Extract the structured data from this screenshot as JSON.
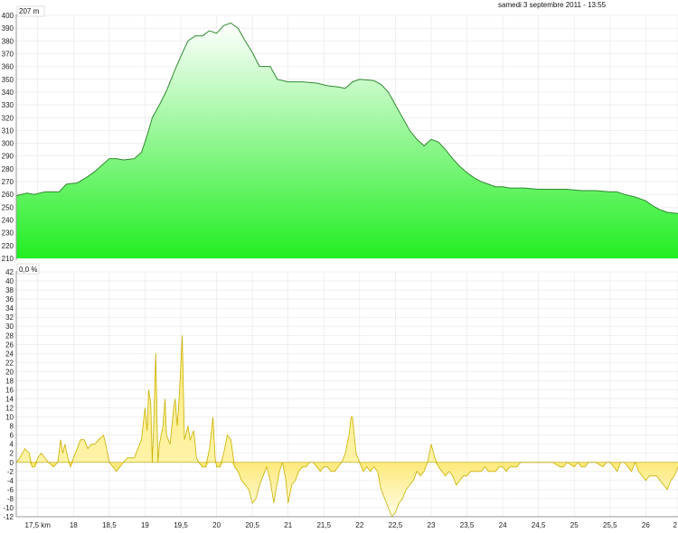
{
  "header": {
    "datetime": "samedi 3 septembre 2011 - 13:55"
  },
  "chart_data": [
    {
      "type": "area",
      "series_kind": "elevation",
      "readout": "207 m",
      "ylim": [
        210,
        400
      ],
      "yticks": [
        210,
        220,
        230,
        240,
        250,
        260,
        270,
        280,
        290,
        300,
        310,
        320,
        330,
        340,
        350,
        360,
        370,
        380,
        390,
        400
      ],
      "xlim": [
        17.2,
        26.45
      ],
      "grid": true,
      "fill_top_color": "#ffffff",
      "fill_bottom_color": "#22ee22",
      "line_color": "#2f8a2f",
      "points": [
        [
          17.2,
          259
        ],
        [
          17.35,
          261
        ],
        [
          17.45,
          260
        ],
        [
          17.6,
          262
        ],
        [
          17.8,
          262
        ],
        [
          17.9,
          268
        ],
        [
          18.05,
          269
        ],
        [
          18.2,
          274
        ],
        [
          18.3,
          278
        ],
        [
          18.4,
          283
        ],
        [
          18.5,
          288
        ],
        [
          18.6,
          288
        ],
        [
          18.7,
          287
        ],
        [
          18.85,
          288
        ],
        [
          18.95,
          293
        ],
        [
          19.0,
          301
        ],
        [
          19.05,
          310
        ],
        [
          19.1,
          320
        ],
        [
          19.2,
          330
        ],
        [
          19.3,
          341
        ],
        [
          19.4,
          355
        ],
        [
          19.5,
          368
        ],
        [
          19.6,
          380
        ],
        [
          19.7,
          384
        ],
        [
          19.8,
          384
        ],
        [
          19.9,
          388
        ],
        [
          20.0,
          386
        ],
        [
          20.1,
          392
        ],
        [
          20.2,
          394
        ],
        [
          20.3,
          390
        ],
        [
          20.4,
          380
        ],
        [
          20.5,
          371
        ],
        [
          20.6,
          360
        ],
        [
          20.75,
          360
        ],
        [
          20.85,
          350
        ],
        [
          21.0,
          348
        ],
        [
          21.2,
          348
        ],
        [
          21.4,
          347
        ],
        [
          21.55,
          345
        ],
        [
          21.7,
          344
        ],
        [
          21.8,
          343
        ],
        [
          21.9,
          348
        ],
        [
          22.0,
          350
        ],
        [
          22.2,
          349
        ],
        [
          22.3,
          346
        ],
        [
          22.4,
          340
        ],
        [
          22.5,
          330
        ],
        [
          22.6,
          320
        ],
        [
          22.7,
          310
        ],
        [
          22.8,
          303
        ],
        [
          22.9,
          298
        ],
        [
          23.0,
          303
        ],
        [
          23.1,
          301
        ],
        [
          23.2,
          295
        ],
        [
          23.3,
          288
        ],
        [
          23.4,
          282
        ],
        [
          23.5,
          277
        ],
        [
          23.6,
          273
        ],
        [
          23.7,
          270
        ],
        [
          23.8,
          268
        ],
        [
          23.9,
          266
        ],
        [
          24.0,
          266
        ],
        [
          24.1,
          265
        ],
        [
          24.3,
          265
        ],
        [
          24.5,
          264
        ],
        [
          24.7,
          264
        ],
        [
          24.9,
          264
        ],
        [
          25.1,
          263
        ],
        [
          25.3,
          263
        ],
        [
          25.5,
          262
        ],
        [
          25.6,
          262
        ],
        [
          25.7,
          260
        ],
        [
          25.85,
          258
        ],
        [
          26.0,
          255
        ],
        [
          26.1,
          251
        ],
        [
          26.2,
          248
        ],
        [
          26.3,
          246
        ],
        [
          26.45,
          245
        ]
      ]
    },
    {
      "type": "area",
      "series_kind": "grade",
      "readout": "0,0 %",
      "ylim": [
        -12,
        42
      ],
      "yticks": [
        -12,
        -10,
        -8,
        -6,
        -4,
        -2,
        0,
        2,
        4,
        6,
        8,
        10,
        12,
        14,
        16,
        18,
        20,
        22,
        24,
        26,
        28,
        30,
        32,
        34,
        36,
        38,
        40,
        42
      ],
      "xlim": [
        17.2,
        26.45
      ],
      "grid": true,
      "fill_top_color": "#ffe97a",
      "fill_bottom_color": "#fffde8",
      "line_color": "#c9b000",
      "xticks": [
        17.5,
        18,
        18.5,
        19,
        19.5,
        20,
        20.5,
        21,
        21.5,
        22,
        22.5,
        23,
        23.5,
        24,
        24.5,
        25,
        25.5,
        26,
        26.45
      ],
      "xtick_labels": [
        "17,5 km",
        "18",
        "18,5",
        "19",
        "19,5",
        "20",
        "20,5",
        "21",
        "21,5",
        "22",
        "22,5",
        "23",
        "23,5",
        "24",
        "24,5",
        "25",
        "25,5",
        "26",
        "2"
      ],
      "points": [
        [
          17.2,
          0
        ],
        [
          17.25,
          1
        ],
        [
          17.32,
          3
        ],
        [
          17.38,
          2
        ],
        [
          17.42,
          -1
        ],
        [
          17.46,
          -1
        ],
        [
          17.5,
          1
        ],
        [
          17.55,
          2
        ],
        [
          17.6,
          1
        ],
        [
          17.65,
          0
        ],
        [
          17.72,
          -1
        ],
        [
          17.78,
          0
        ],
        [
          17.82,
          5
        ],
        [
          17.85,
          2
        ],
        [
          17.88,
          4
        ],
        [
          17.92,
          1
        ],
        [
          17.96,
          -1
        ],
        [
          18.0,
          1
        ],
        [
          18.05,
          3
        ],
        [
          18.1,
          5
        ],
        [
          18.15,
          5
        ],
        [
          18.2,
          3
        ],
        [
          18.25,
          4
        ],
        [
          18.3,
          4
        ],
        [
          18.35,
          5
        ],
        [
          18.42,
          6
        ],
        [
          18.45,
          4
        ],
        [
          18.5,
          0
        ],
        [
          18.55,
          -1
        ],
        [
          18.6,
          -2
        ],
        [
          18.65,
          -1
        ],
        [
          18.7,
          0
        ],
        [
          18.75,
          1
        ],
        [
          18.8,
          1
        ],
        [
          18.85,
          1
        ],
        [
          18.9,
          3
        ],
        [
          18.95,
          5
        ],
        [
          19.0,
          12
        ],
        [
          19.03,
          7
        ],
        [
          19.05,
          16
        ],
        [
          19.08,
          13
        ],
        [
          19.1,
          0
        ],
        [
          19.12,
          8
        ],
        [
          19.15,
          24
        ],
        [
          19.18,
          0
        ],
        [
          19.2,
          4
        ],
        [
          19.25,
          8
        ],
        [
          19.28,
          14
        ],
        [
          19.3,
          6
        ],
        [
          19.35,
          4
        ],
        [
          19.4,
          12
        ],
        [
          19.42,
          14
        ],
        [
          19.45,
          8
        ],
        [
          19.48,
          15
        ],
        [
          19.52,
          28
        ],
        [
          19.55,
          5
        ],
        [
          19.6,
          8
        ],
        [
          19.63,
          5
        ],
        [
          19.68,
          7
        ],
        [
          19.72,
          1
        ],
        [
          19.75,
          0
        ],
        [
          19.8,
          -1
        ],
        [
          19.85,
          -1
        ],
        [
          19.9,
          3
        ],
        [
          19.95,
          10
        ],
        [
          19.98,
          1
        ],
        [
          20.0,
          -1
        ],
        [
          20.05,
          -1
        ],
        [
          20.1,
          2
        ],
        [
          20.15,
          6
        ],
        [
          20.2,
          5
        ],
        [
          20.25,
          -1
        ],
        [
          20.3,
          -2
        ],
        [
          20.35,
          -4
        ],
        [
          20.4,
          -5
        ],
        [
          20.45,
          -6
        ],
        [
          20.5,
          -9
        ],
        [
          20.55,
          -8
        ],
        [
          20.6,
          -5
        ],
        [
          20.65,
          -3
        ],
        [
          20.7,
          -1
        ],
        [
          20.75,
          -4
        ],
        [
          20.8,
          -9
        ],
        [
          20.83,
          -6
        ],
        [
          20.88,
          -2
        ],
        [
          20.92,
          0
        ],
        [
          20.97,
          -4
        ],
        [
          21.0,
          -9
        ],
        [
          21.05,
          -5
        ],
        [
          21.1,
          -4
        ],
        [
          21.15,
          -2
        ],
        [
          21.2,
          -1
        ],
        [
          21.25,
          -1
        ],
        [
          21.3,
          0
        ],
        [
          21.35,
          0
        ],
        [
          21.4,
          -1
        ],
        [
          21.45,
          -2
        ],
        [
          21.5,
          -1
        ],
        [
          21.55,
          -1
        ],
        [
          21.6,
          -2
        ],
        [
          21.65,
          -2
        ],
        [
          21.7,
          -1
        ],
        [
          21.75,
          0
        ],
        [
          21.8,
          2
        ],
        [
          21.85,
          6
        ],
        [
          21.88,
          10
        ],
        [
          21.9,
          10
        ],
        [
          21.95,
          2
        ],
        [
          22.0,
          0
        ],
        [
          22.05,
          -2
        ],
        [
          22.1,
          -1
        ],
        [
          22.15,
          -2
        ],
        [
          22.2,
          -1
        ],
        [
          22.25,
          -2
        ],
        [
          22.3,
          -6
        ],
        [
          22.35,
          -8
        ],
        [
          22.4,
          -10
        ],
        [
          22.45,
          -12
        ],
        [
          22.5,
          -11
        ],
        [
          22.55,
          -9
        ],
        [
          22.6,
          -8
        ],
        [
          22.65,
          -6
        ],
        [
          22.7,
          -5
        ],
        [
          22.75,
          -4
        ],
        [
          22.8,
          -2
        ],
        [
          22.85,
          -3
        ],
        [
          22.9,
          -2
        ],
        [
          22.95,
          0
        ],
        [
          23.0,
          4
        ],
        [
          23.05,
          1
        ],
        [
          23.1,
          -1
        ],
        [
          23.15,
          -2
        ],
        [
          23.2,
          -3
        ],
        [
          23.25,
          -2
        ],
        [
          23.3,
          -3
        ],
        [
          23.35,
          -5
        ],
        [
          23.4,
          -4
        ],
        [
          23.45,
          -3
        ],
        [
          23.5,
          -3
        ],
        [
          23.55,
          -2
        ],
        [
          23.6,
          -2
        ],
        [
          23.65,
          -2
        ],
        [
          23.7,
          -2
        ],
        [
          23.75,
          -1
        ],
        [
          23.8,
          -2
        ],
        [
          23.85,
          -2
        ],
        [
          23.9,
          -2
        ],
        [
          23.95,
          -1
        ],
        [
          24.0,
          -1
        ],
        [
          24.05,
          -2
        ],
        [
          24.1,
          -1
        ],
        [
          24.15,
          -1
        ],
        [
          24.2,
          -1
        ],
        [
          24.25,
          0
        ],
        [
          24.3,
          0
        ],
        [
          24.4,
          0
        ],
        [
          24.5,
          0
        ],
        [
          24.6,
          0
        ],
        [
          24.7,
          0
        ],
        [
          24.8,
          -1
        ],
        [
          24.85,
          -1
        ],
        [
          24.9,
          0
        ],
        [
          25.0,
          -1
        ],
        [
          25.05,
          0
        ],
        [
          25.1,
          -1
        ],
        [
          25.15,
          -1
        ],
        [
          25.2,
          0
        ],
        [
          25.3,
          0
        ],
        [
          25.4,
          -1
        ],
        [
          25.45,
          0
        ],
        [
          25.5,
          0
        ],
        [
          25.55,
          -1
        ],
        [
          25.6,
          -2
        ],
        [
          25.65,
          0
        ],
        [
          25.7,
          0
        ],
        [
          25.75,
          -1
        ],
        [
          25.8,
          -2
        ],
        [
          25.85,
          0
        ],
        [
          25.9,
          -2
        ],
        [
          25.95,
          -3
        ],
        [
          26.0,
          -4
        ],
        [
          26.05,
          -3
        ],
        [
          26.1,
          -3
        ],
        [
          26.15,
          -3
        ],
        [
          26.2,
          -4
        ],
        [
          26.25,
          -5
        ],
        [
          26.3,
          -6
        ],
        [
          26.35,
          -4
        ],
        [
          26.4,
          -3
        ],
        [
          26.45,
          -1
        ]
      ]
    }
  ]
}
